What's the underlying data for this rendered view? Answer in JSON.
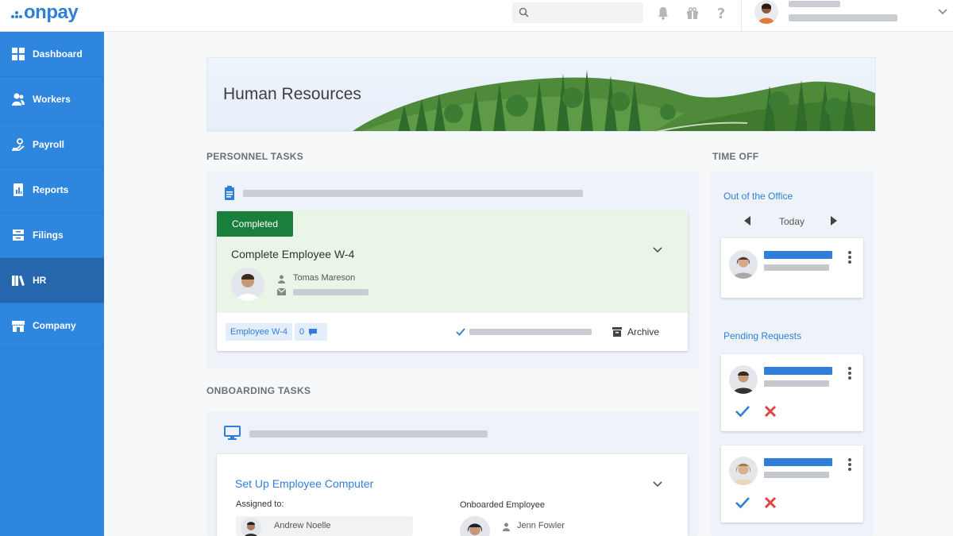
{
  "app": {
    "logo": "onpay",
    "search_placeholder": ""
  },
  "sidebar": {
    "items": [
      {
        "label": "Dashboard",
        "icon": "grid-icon"
      },
      {
        "label": "Workers",
        "icon": "users-icon"
      },
      {
        "label": "Payroll",
        "icon": "payroll-icon"
      },
      {
        "label": "Reports",
        "icon": "report-icon"
      },
      {
        "label": "Filings",
        "icon": "filings-icon"
      },
      {
        "label": "HR",
        "icon": "books-icon"
      },
      {
        "label": "Company",
        "icon": "store-icon"
      }
    ],
    "active_index": 5
  },
  "banner": {
    "title": "Human Resources"
  },
  "personnel": {
    "section_label": "PERSONNEL TASKS",
    "task": {
      "status": "Completed",
      "title": "Complete Employee W-4",
      "person_name": "Tomas Mareson",
      "tag": "Employee W-4",
      "comments_count": "0",
      "archive_label": "Archive"
    }
  },
  "onboarding": {
    "section_label": "ONBOARDING TASKS",
    "task": {
      "title": "Set Up Employee Computer",
      "assigned_label": "Assigned to:",
      "assigned_name": "Andrew Noelle",
      "onboarded_label": "Onboarded Employee",
      "onboarded_name": "Jenn Fowler"
    }
  },
  "time_off": {
    "section_label": "TIME OFF",
    "out_of_office_title": "Out of the Office",
    "day_label": "Today",
    "pending_title": "Pending Requests"
  },
  "colors": {
    "primary": "#2f86de",
    "sidebar_active": "#2566ad",
    "success": "#1a7e3c",
    "reject": "#e04545"
  }
}
